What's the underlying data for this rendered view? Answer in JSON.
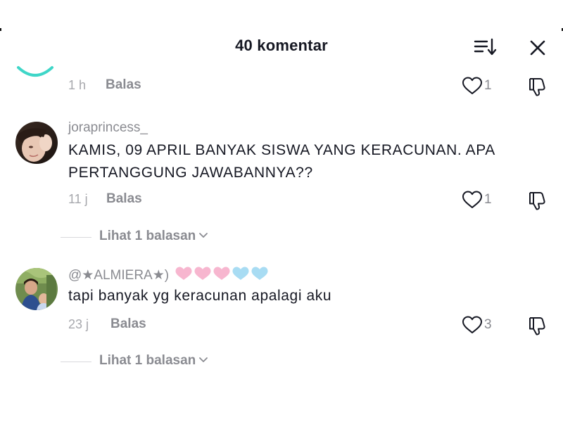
{
  "header": {
    "title": "40 komentar",
    "sort_icon": "sort-icon",
    "close_icon": "close-icon"
  },
  "colors": {
    "text_primary": "#161823",
    "text_secondary": "#8a8b91",
    "text_muted": "#a7a8ad",
    "avatar_ring": "#3fd6c8",
    "heart_pink": "#f7b6cf",
    "heart_blue": "#a8dcf3"
  },
  "comments": [
    {
      "partial": true,
      "time": "1 h",
      "reply_label": "Balas",
      "likes": "1"
    },
    {
      "username": "joraprincess_",
      "text": "KAMIS, 09 APRIL BANYAK SISWA YANG KERACUNAN. APA PERTANGGUNG JAWABANNYA??",
      "time": "11 j",
      "reply_label": "Balas",
      "likes": "1",
      "view_replies": "Lihat 1 balasan"
    },
    {
      "username": "@★ALMIERA★)",
      "username_hearts": [
        "pink",
        "pink",
        "pink",
        "blue",
        "blue"
      ],
      "text": "tapi banyak yg keracunan apalagi aku",
      "time": "23 j",
      "reply_label": "Balas",
      "likes": "3",
      "view_replies": "Lihat 1 balasan"
    }
  ]
}
